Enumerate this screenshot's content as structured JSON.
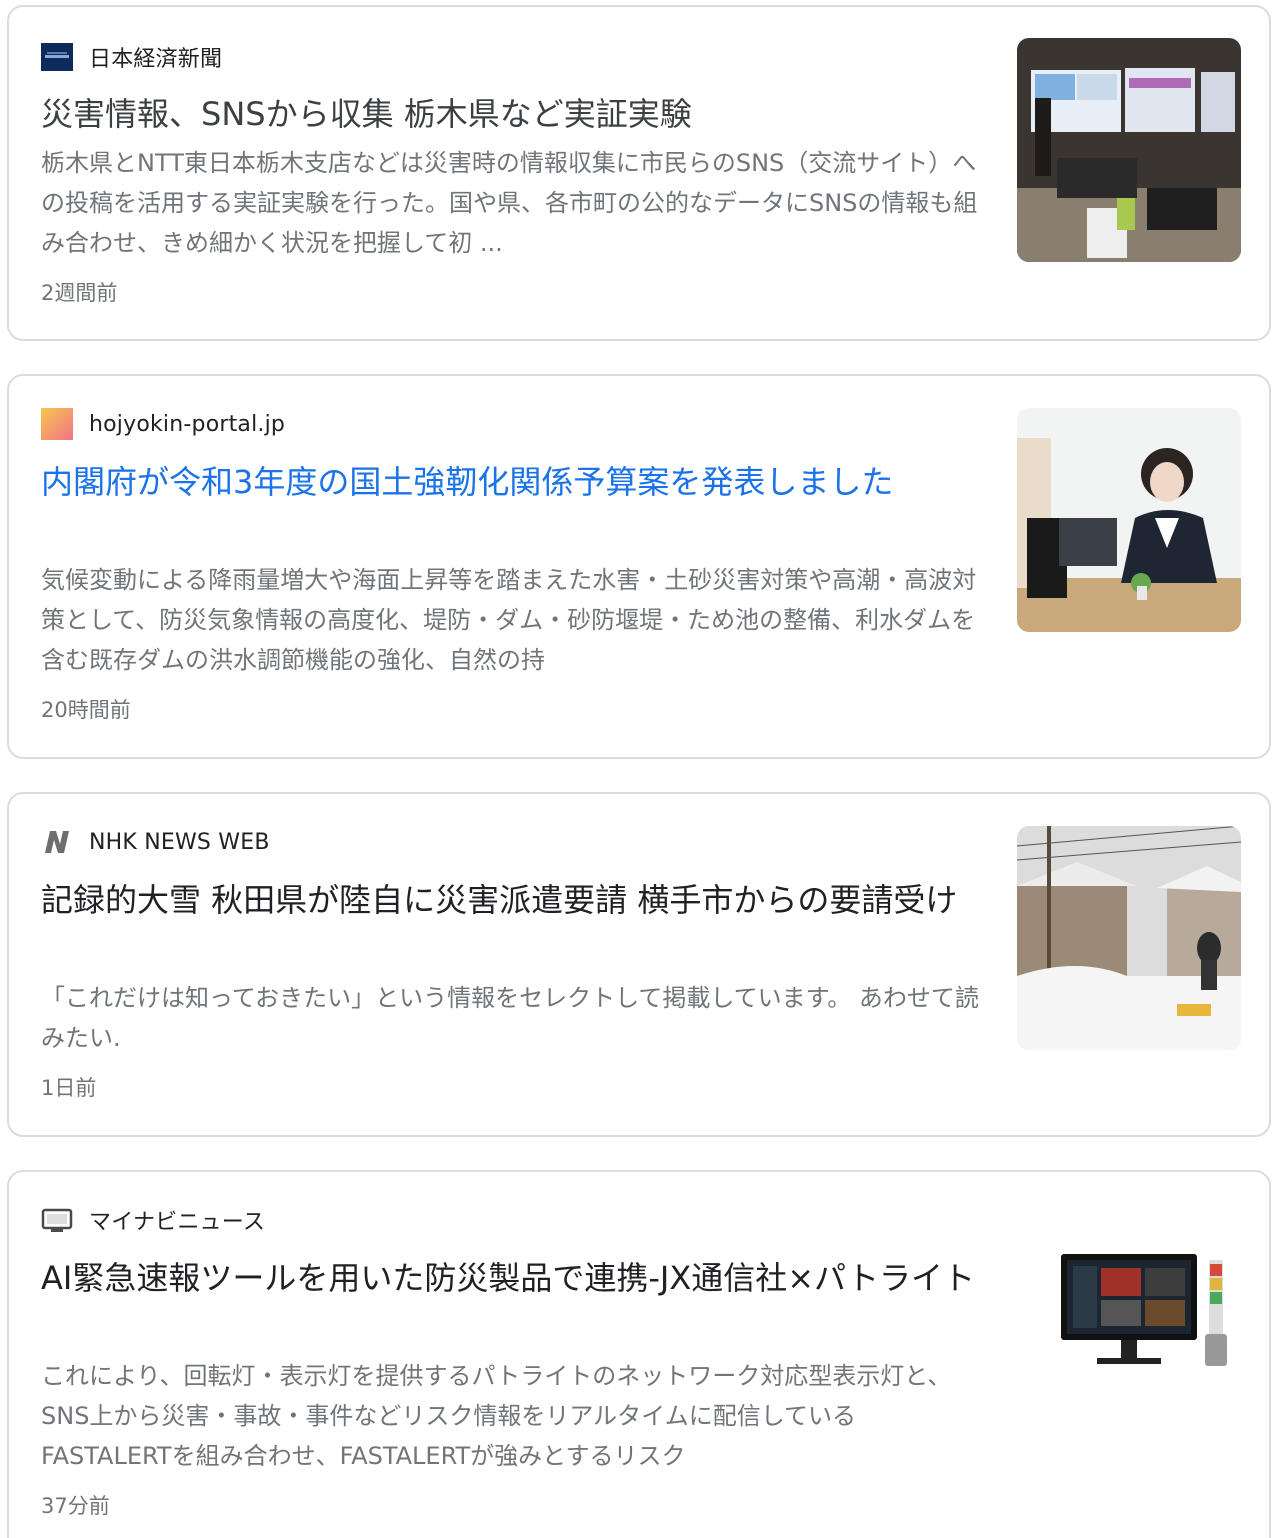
{
  "articles": [
    {
      "source": "日本経済新聞",
      "source_icon": "nikkei-logo-icon",
      "title": "災害情報、SNSから収集 栃木県など実証実験",
      "snippet": "栃木県とNTT東日本栃木支店などは災害時の情報収集に市民らのSNS（交流サイト）への投稿を活用する実証実験を行った。国や県、各市町の公的なデータにSNSの情報も組み合わせ、きめ細かく状況を把握して初 ...",
      "age": "2週間前",
      "thumbnail": "control-room-photo"
    },
    {
      "source": "hojyokin-portal.jp",
      "source_icon": "hojyokin-gradient-icon",
      "title": "内閣府が令和3年度の国土強靭化関係予算案を発表しました",
      "snippet": "気候変動による降雨量増大や海面上昇等を踏まえた水害・土砂災害対策や高潮・高波対策として、防災気象情報の高度化、堤防・ダム・砂防堰堤・ため池の整備、利水ダムを含む既存ダムの洪水調節機能の強化、自然の持",
      "age": "20時間前",
      "thumbnail": "business-consultation-photo"
    },
    {
      "source": "NHK NEWS WEB",
      "source_icon": "nhk-n-icon",
      "title": "記録的大雪 秋田県が陸自に災害派遣要請 横手市からの要請受け",
      "snippet": "「これだけは知っておきたい」という情報をセレクトして掲載しています。 あわせて読みたい.",
      "age": "1日前",
      "thumbnail": "snowy-street-photo"
    },
    {
      "source": "マイナビニュース",
      "source_icon": "tv-monitor-icon",
      "title": "AI緊急速報ツールを用いた防災製品で連携-JX通信社×パトライト",
      "snippet": "これにより、回転灯・表示灯を提供するパトライトのネットワーク対応型表示灯と、SNS上から災害・事故・事件などリスク情報をリアルタイムに配信しているFASTALERTを組み合わせ、FASTALERTが強みとするリスク",
      "age": "37分前",
      "thumbnail": "monitor-and-signal-tower-photo"
    }
  ],
  "colors": {
    "link": "#1a73e8",
    "title": "#3c4043",
    "snippet": "#70757a",
    "border": "#dadce0"
  }
}
